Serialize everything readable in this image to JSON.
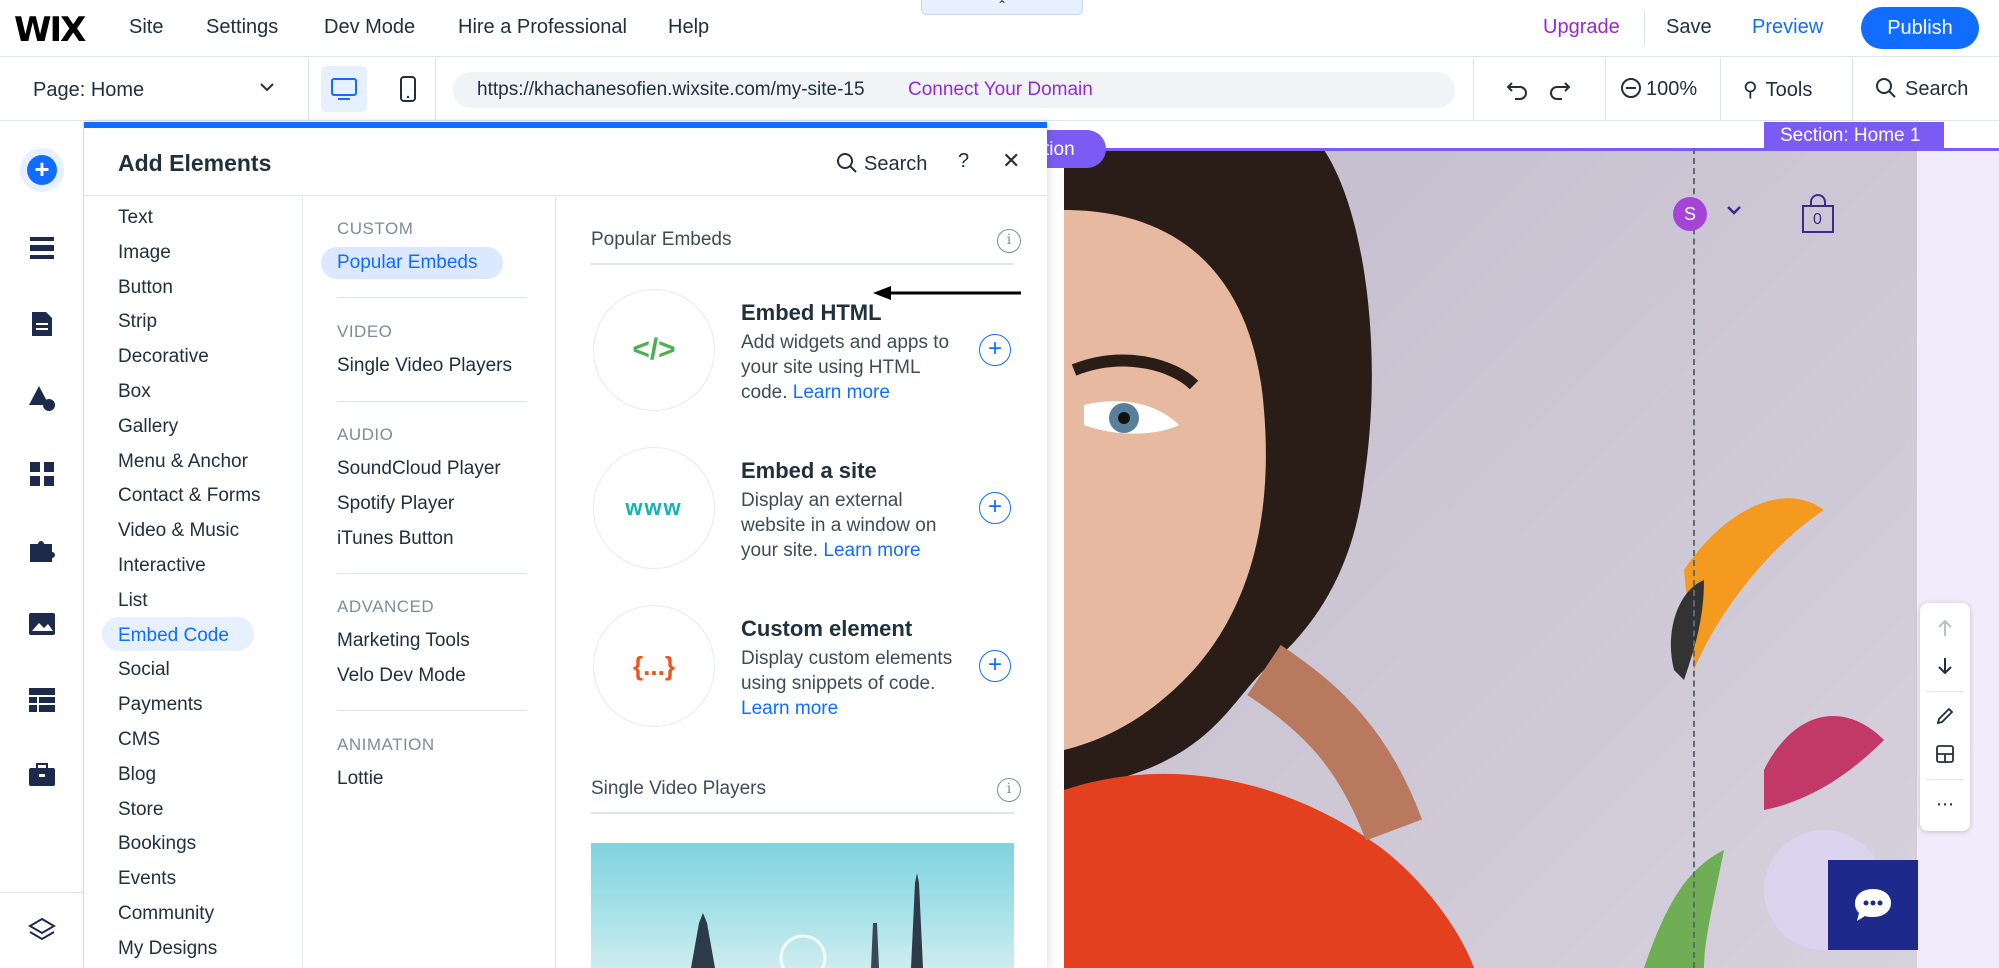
{
  "topbar": {
    "logo": "WIX",
    "menu": [
      "Site",
      "Settings",
      "Dev Mode",
      "Hire a Professional",
      "Help"
    ],
    "upgrade": "Upgrade",
    "save": "Save",
    "preview": "Preview",
    "publish": "Publish",
    "accent": "#116dff",
    "upgrade_color": "#9a27d5"
  },
  "bar2": {
    "page": "Page: Home",
    "url": "https://khachanesofien.wixsite.com/my-site-15",
    "connect": "Connect Your Domain",
    "zoom": "100%",
    "tools": "Tools",
    "search": "Search"
  },
  "canvas": {
    "section_label": "Section: Home 1",
    "section_pill": "tion",
    "avatar_letter": "S",
    "cart_count": "0"
  },
  "panel": {
    "title": "Add Elements",
    "search": "Search",
    "help": "?",
    "close": "✕",
    "categories": [
      "Text",
      "Image",
      "Button",
      "Strip",
      "Decorative",
      "Box",
      "Gallery",
      "Menu & Anchor",
      "Contact & Forms",
      "Video & Music",
      "Interactive",
      "List",
      "Embed Code",
      "Social",
      "Payments",
      "CMS",
      "Blog",
      "Store",
      "Bookings",
      "Events",
      "Community",
      "My Designs"
    ],
    "active_category": "Embed Code",
    "groups": [
      {
        "label": "CUSTOM",
        "items": [
          "Popular Embeds"
        ]
      },
      {
        "label": "VIDEO",
        "items": [
          "Single Video Players"
        ]
      },
      {
        "label": "AUDIO",
        "items": [
          "SoundCloud Player",
          "Spotify Player",
          "iTunes Button"
        ]
      },
      {
        "label": "ADVANCED",
        "items": [
          "Marketing Tools",
          "Velo Dev Mode"
        ]
      },
      {
        "label": "ANIMATION",
        "items": [
          "Lottie"
        ]
      }
    ],
    "active_sub": "Popular Embeds",
    "section1": "Popular Embeds",
    "section2": "Single Video Players",
    "items": [
      {
        "icon": "</>",
        "title": "Embed HTML",
        "desc": "Add widgets and apps to your site using HTML code.",
        "learn": "Learn more",
        "icon_color": "#4caf50"
      },
      {
        "icon": "www",
        "title": "Embed a site",
        "desc": "Display an external website in a window on your site.",
        "learn": "Learn more",
        "icon_color": "#17b2b5"
      },
      {
        "icon": "{...}",
        "title": "Custom element",
        "desc": "Display custom elements using snippets of code.",
        "learn": "Learn more",
        "icon_color": "#f4511e"
      }
    ]
  }
}
